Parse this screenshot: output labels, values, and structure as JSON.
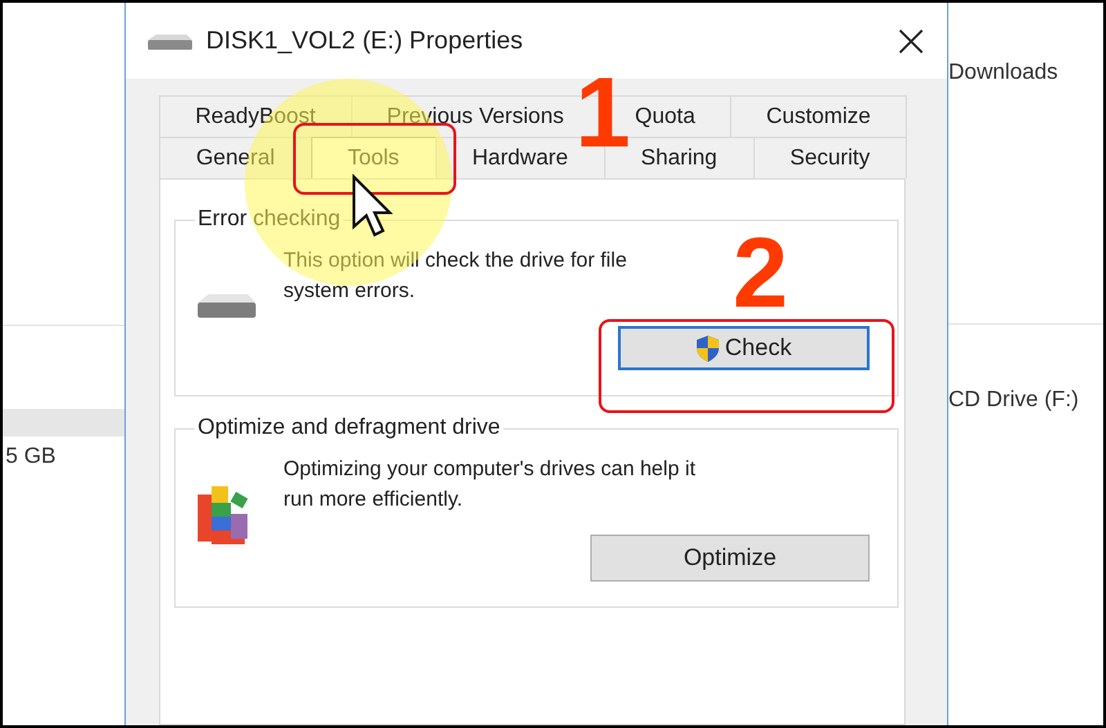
{
  "background": {
    "left_items": [
      {
        "label": "5 GB"
      }
    ],
    "right_items": [
      {
        "label": "Downloads"
      },
      {
        "label": "CD Drive (F:)"
      }
    ]
  },
  "window": {
    "title": "DISK1_VOL2 (E:) Properties"
  },
  "tab_rows": [
    {
      "tabs": [
        {
          "label": "ReadyBoost",
          "selected": false
        },
        {
          "label": "Previous Versions",
          "selected": false
        },
        {
          "label": "Quota",
          "selected": false
        },
        {
          "label": "Customize",
          "selected": false
        }
      ]
    },
    {
      "tabs": [
        {
          "label": "General",
          "selected": false
        },
        {
          "label": "Tools",
          "selected": true
        },
        {
          "label": "Hardware",
          "selected": false
        },
        {
          "label": "Sharing",
          "selected": false
        },
        {
          "label": "Security",
          "selected": false
        }
      ]
    }
  ],
  "groups": [
    {
      "kind": "error-checking",
      "title": "Error checking",
      "text": "This option will check the drive for file system errors.",
      "button": {
        "label": "Check",
        "shield": true,
        "focused": true
      }
    },
    {
      "kind": "optimize",
      "title": "Optimize and defragment drive",
      "text": "Optimizing your computer's drives can help it run more efficiently.",
      "button": {
        "label": "Optimize",
        "shield": false,
        "focused": false
      }
    }
  ],
  "annotations": [
    {
      "label": "1"
    },
    {
      "label": "2"
    }
  ]
}
